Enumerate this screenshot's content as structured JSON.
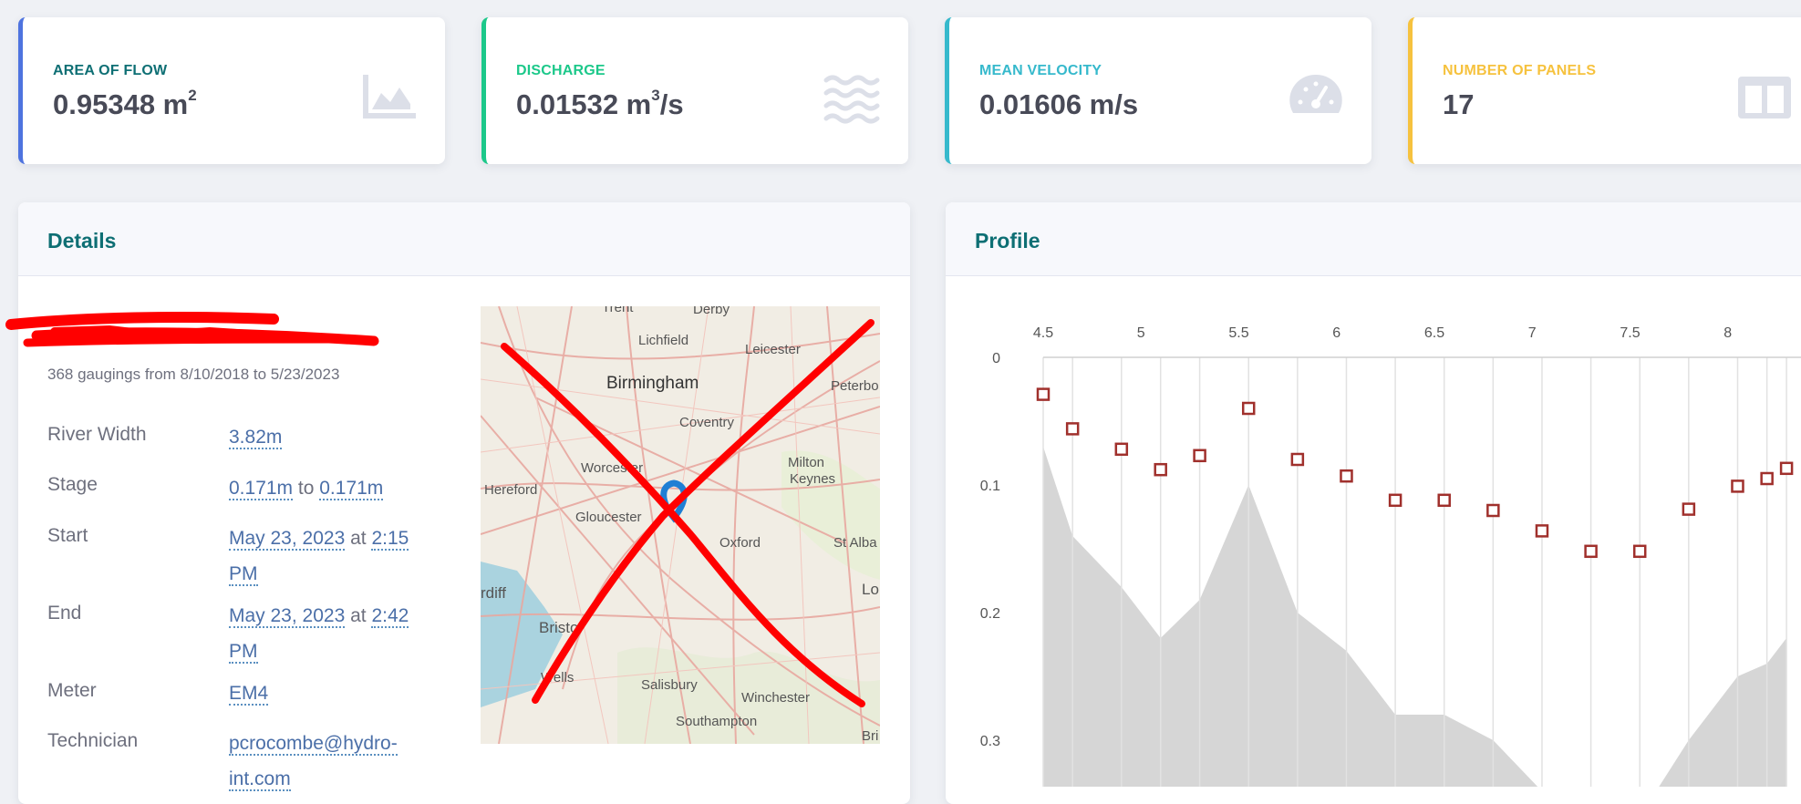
{
  "kpis": [
    {
      "label": "AREA OF FLOW",
      "value": "0.95348 m",
      "sup": "2",
      "icon": "area-chart-icon",
      "accent": "#4e73df",
      "label_color": "#0e6f74"
    },
    {
      "label": "DISCHARGE",
      "value": "0.01532 m",
      "sup": "3",
      "value_suffix": "/s",
      "icon": "water-icon",
      "accent": "#1cc88a"
    },
    {
      "label": "MEAN VELOCITY",
      "value": "0.01606 m/s",
      "icon": "speedometer-icon",
      "accent": "#36b9cc"
    },
    {
      "label": "NUMBER OF PANELS",
      "value": "17",
      "icon": "columns-icon",
      "accent": "#f6c23e"
    }
  ],
  "details": {
    "title": "Details",
    "subtitle": "368 gaugings from 8/10/2018 to 5/23/2023",
    "river_width": {
      "label": "River Width",
      "value": "3.82m"
    },
    "stage": {
      "label": "Stage",
      "from": "0.171m",
      "to_word": "to",
      "to": "0.171m"
    },
    "start": {
      "label": "Start",
      "date": "May 23, 2023",
      "at_word": "at",
      "time": "2:15 PM"
    },
    "end": {
      "label": "End",
      "date": "May 23, 2023",
      "at_word": "at",
      "time": "2:42 PM"
    },
    "meter": {
      "label": "Meter",
      "value": "EM4"
    },
    "technician": {
      "label": "Technician",
      "value": "pcrocombe@hydro-int.com"
    }
  },
  "map": {
    "places": [
      "Trent",
      "Derby",
      "Lichfield",
      "Leicester",
      "Birmingham",
      "Peterbo",
      "Coventry",
      "Worcester",
      "Milton",
      "Keynes",
      "Hereford",
      "Gloucester",
      "Oxford",
      "St Alba",
      "Lo",
      "rdiff",
      "Bristol",
      "Wells",
      "Salisbury",
      "Winchester",
      "Southampton",
      "Bri"
    ]
  },
  "profile": {
    "title": "Profile"
  },
  "chart_data": {
    "type": "scatter",
    "x_axis_position": "top",
    "x_ticks": [
      4.5,
      5,
      5.5,
      6,
      6.5,
      7,
      7.5,
      8
    ],
    "y_ticks": [
      0,
      0.1,
      0.2,
      0.3
    ],
    "y_inverted": true,
    "grid": true,
    "points": {
      "x": [
        4.5,
        4.65,
        4.9,
        5.1,
        5.3,
        5.55,
        5.8,
        6.05,
        6.3,
        6.55,
        6.8,
        7.05,
        7.3,
        7.55,
        7.8,
        8.05,
        8.2,
        8.3
      ],
      "y": [
        0.029,
        0.056,
        0.072,
        0.088,
        0.077,
        0.04,
        0.08,
        0.093,
        0.112,
        0.112,
        0.12,
        0.136,
        0.152,
        0.152,
        0.119,
        0.101,
        0.095,
        0.087
      ],
      "marker": "square",
      "color": "#a0302c"
    },
    "bed_profile": {
      "x": [
        4.5,
        4.65,
        4.9,
        5.1,
        5.3,
        5.55,
        5.8,
        6.05,
        6.3,
        6.55,
        6.8,
        7.05,
        7.3,
        7.55,
        7.8,
        8.05,
        8.2,
        8.3
      ],
      "y": [
        0.07,
        0.14,
        0.18,
        0.22,
        0.19,
        0.1,
        0.2,
        0.23,
        0.28,
        0.28,
        0.3,
        0.34,
        0.36,
        0.36,
        0.3,
        0.25,
        0.24,
        0.22
      ],
      "color": "#d6d6d6"
    },
    "xlim": [
      4.5,
      8.3
    ],
    "ylim": [
      0,
      0.34
    ]
  }
}
